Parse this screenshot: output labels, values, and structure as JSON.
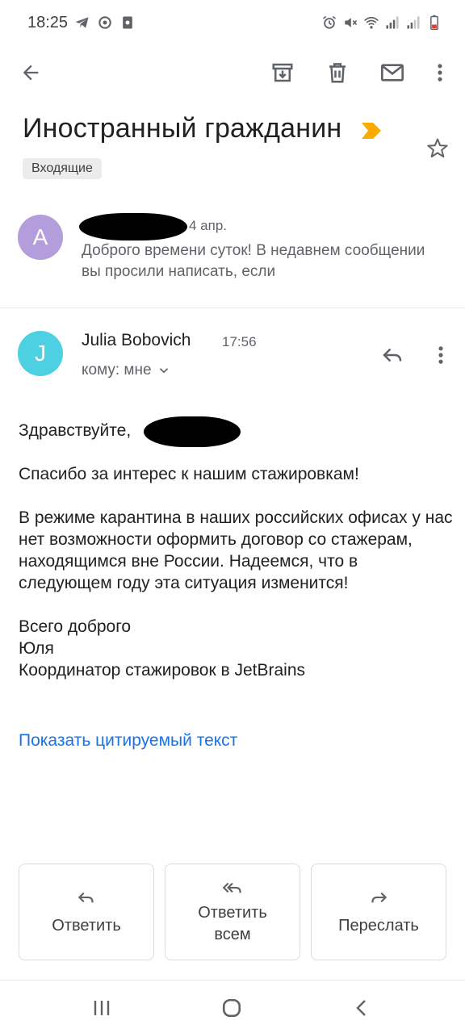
{
  "status_bar": {
    "time": "18:25",
    "left_icons": [
      "telegram-icon",
      "target-icon",
      "app-notification-icon"
    ],
    "right_icons": [
      "alarm-icon",
      "mute-icon",
      "wifi-icon",
      "signal-icon",
      "signal-icon",
      "battery-icon"
    ]
  },
  "toolbar": {
    "icons": [
      "back-arrow-icon",
      "archive-icon",
      "delete-icon",
      "mark-unread-icon",
      "more-vert-icon"
    ]
  },
  "email": {
    "subject": "Иностранный гражданин",
    "label": "Входящие",
    "important_color": "#f9ab00"
  },
  "collapsed_message": {
    "avatar_letter": "A",
    "avatar_color": "#b39ddb",
    "date": "4 апр.",
    "snippet": "Доброго времени суток! В недавнем сообщении вы просили написать, если"
  },
  "message": {
    "avatar_letter": "J",
    "avatar_color": "#4dd0e1",
    "sender": "Julia Bobovich",
    "time": "17:56",
    "recipient": "кому: мне",
    "greeting": "Здравствуйте, ",
    "paragraph1": "Спасибо за интерес к нашим стажировкам!",
    "paragraph2": "В режиме карантина в наших российских офисах у нас нет возможности оформить договор со стажерам, находящимся вне России. Надеемся, что в следующем году эта ситуация изменится!",
    "sign_line1": "Всего доброго",
    "sign_line2": "Юля",
    "sign_line3": "Координатор стажировок в JetBrains",
    "show_quoted": "Показать цитируемый текст"
  },
  "actions": {
    "reply": "Ответить",
    "reply_all_line1": "Ответить",
    "reply_all_line2": "всем",
    "forward": "Переслать"
  },
  "navbar": {
    "icons": [
      "recents-icon",
      "home-icon",
      "back-icon"
    ]
  }
}
